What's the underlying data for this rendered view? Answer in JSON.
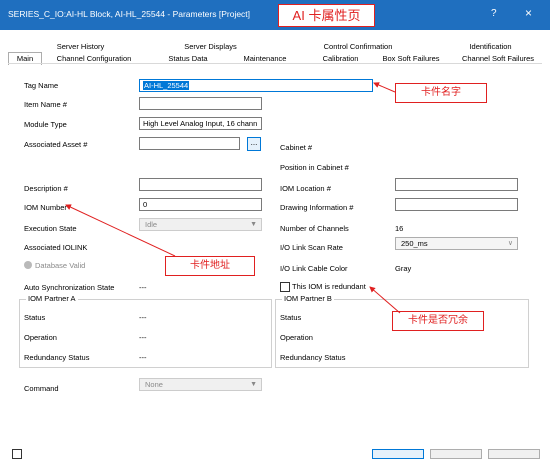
{
  "window": {
    "title": "SERIES_C_IO:AI-HL Block, AI-HL_25544 - Parameters [Project]",
    "help_label": "?",
    "close_label": "×"
  },
  "annotations": {
    "page_title": "AI 卡属性页",
    "card_name": "卡件名字",
    "card_address": "卡件地址",
    "card_redundant": "卡件是否冗余"
  },
  "tabs_row1": [
    "Server History",
    "Server Displays",
    "Control Confirmation",
    "Identification"
  ],
  "tabs_row2": [
    "Main",
    "Channel Configuration",
    "Status Data",
    "Maintenance",
    "Calibration",
    "Box Soft Failures",
    "Channel Soft Failures"
  ],
  "form": {
    "tag_name_label": "Tag Name",
    "tag_name_value": "AI-HL_25544",
    "item_name_label": "Item Name #",
    "item_name_value": "",
    "module_type_label": "Module Type",
    "module_type_value": "High Level Analog Input, 16 chann",
    "associated_asset_label": "Associated Asset #",
    "associated_asset_value": "",
    "browse_label": "...",
    "cabinet_label": "Cabinet #",
    "position_label": "Position in Cabinet #",
    "description_label": "Description #",
    "description_value": "",
    "iom_location_label": "IOM Location #",
    "iom_location_value": "",
    "iom_number_label": "IOM Number",
    "iom_number_value": "0",
    "drawing_info_label": "Drawing Information #",
    "drawing_info_value": "",
    "execution_state_label": "Execution State",
    "execution_state_value": "Idle",
    "num_channels_label": "Number of Channels",
    "num_channels_value": "16",
    "associated_iolink_label": "Associated IOLINK",
    "scan_rate_label": "I/O Link Scan Rate",
    "scan_rate_value": "250_ms",
    "database_valid_label": "Database Valid",
    "cable_color_label": "I/O Link Cable Color",
    "cable_color_value": "Gray",
    "auto_sync_label": "Auto Synchronization State",
    "auto_sync_value": "---",
    "redundant_label": "This IOM is redundant",
    "partner_a_title": "IOM Partner A",
    "partner_a_status_label": "Status",
    "partner_a_status_value": "---",
    "partner_a_operation_label": "Operation",
    "partner_a_operation_value": "---",
    "partner_a_redundancy_label": "Redundancy Status",
    "partner_a_redundancy_value": "---",
    "partner_b_title": "IOM Partner B",
    "partner_b_status_label": "Status",
    "partner_b_operation_label": "Operation",
    "partner_b_redundancy_label": "Redundancy Status",
    "command_label": "Command",
    "command_value": "None"
  },
  "colors": {
    "titlebar": "#1f6fbf",
    "annotation": "#e02020",
    "selection": "#0078d7"
  },
  "icons": {
    "dropdown": "chevron-down-icon",
    "led": "status-led-icon"
  }
}
